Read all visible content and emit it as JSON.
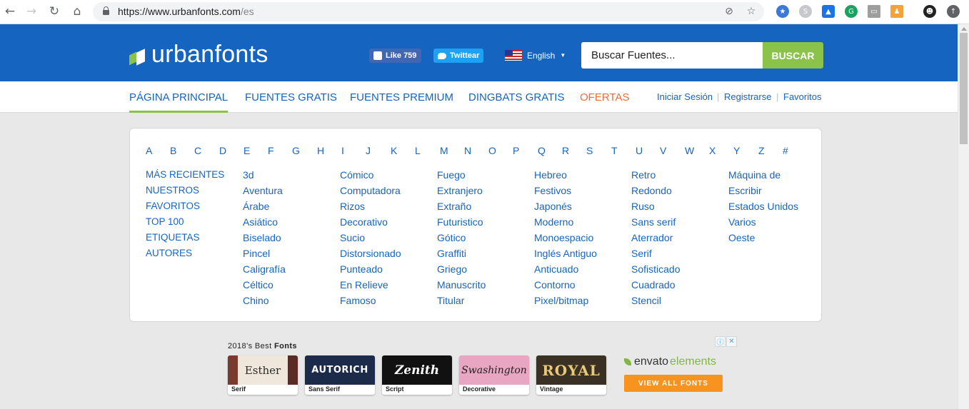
{
  "browser": {
    "url_host": "https://www.urbanfonts.com",
    "url_path": "/es"
  },
  "site": {
    "logo_text": "urbanfonts",
    "fb_like_label": "Like 759",
    "twitter_label": "Twittear",
    "language_label": "English",
    "search_placeholder": "Buscar Fuentes...",
    "search_button": "BUSCAR",
    "colors": {
      "header_blue": "#1565c0",
      "accent_green": "#8bc34a",
      "offers_orange": "#ef6c3a"
    }
  },
  "nav": {
    "items": [
      "PÁGINA PRINCIPAL",
      "FUENTES GRATIS",
      "FUENTES PREMIUM",
      "DINGBATS GRATIS",
      "OFERTAS"
    ],
    "account": [
      "Iniciar Sesión",
      "Registrarse",
      "Favoritos"
    ]
  },
  "letters": [
    "A",
    "B",
    "C",
    "D",
    "E",
    "F",
    "G",
    "H",
    "I",
    "J",
    "K",
    "L",
    "M",
    "N",
    "O",
    "P",
    "Q",
    "R",
    "S",
    "T",
    "U",
    "V",
    "W",
    "X",
    "Y",
    "Z",
    "#"
  ],
  "categories": {
    "col1": [
      "MÁS RECIENTES",
      "NUESTROS",
      "FAVORITOS",
      "TOP 100",
      "ETIQUETAS",
      "AUTORES"
    ],
    "col2": [
      "3d",
      "Aventura",
      "Árabe",
      "Asiático",
      "Biselado",
      "Pincel",
      "Caligrafía",
      "Céltico",
      "Chino"
    ],
    "col3": [
      "Cómico",
      "Computadora",
      "Rizos",
      "Decorativo",
      "Sucio",
      "Distorsionado",
      "Punteado",
      "En Relieve",
      "Famoso"
    ],
    "col4": [
      "Fuego",
      "Extranjero",
      "Extraño",
      "Futuristico",
      "Gótico",
      "Graffiti",
      "Griego",
      "Manuscrito",
      "Titular"
    ],
    "col5": [
      "Hebreo",
      "Festivos",
      "Japonés",
      "Moderno",
      "Monoespacio",
      "Inglés Antiguo",
      "Anticuado",
      "Contorno",
      "Pixel/bitmap"
    ],
    "col6": [
      "Retro",
      "Redondo",
      "Ruso",
      "Sans serif",
      "Aterrador",
      "Serif",
      "Sofisticado",
      "Cuadrado",
      "Stencil"
    ],
    "col7": [
      "Máquina de",
      "Escribir",
      "Estados Unidos",
      "Varios",
      "Oeste"
    ]
  },
  "ad": {
    "title_prefix": "2018's Best ",
    "title_bold": "Fonts",
    "thumbs": [
      {
        "art": "Esther",
        "label": "Serif"
      },
      {
        "art": "AUTORICH",
        "label": "Sans Serif"
      },
      {
        "art": "Zenith",
        "label": "Script"
      },
      {
        "art": "Swashington",
        "label": "Decorative"
      },
      {
        "art": "ROYAL",
        "label": "Vintage"
      }
    ],
    "brand_a": "envato",
    "brand_b": "elements",
    "cta": "VIEW ALL FONTS",
    "info_icon": "ⓘ",
    "close_icon": "✕"
  }
}
